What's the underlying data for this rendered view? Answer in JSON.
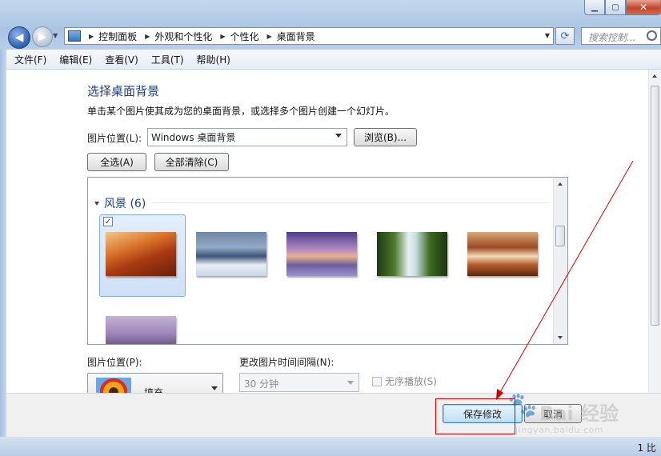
{
  "window": {
    "controls": {
      "minimize": "▁",
      "maximize": "▢",
      "close": "✕"
    }
  },
  "navigation": {
    "back_glyph": "◀",
    "forward_glyph": "▶",
    "history_glyph": "▼"
  },
  "address_bar": {
    "crumbs": [
      "控制面板",
      "外观和个性化",
      "个性化",
      "桌面背景"
    ],
    "separator": "▶",
    "dropdown_glyph": "▼",
    "refresh_glyph": "⟳"
  },
  "search": {
    "placeholder": "搜索控制..."
  },
  "menu": {
    "items": [
      "文件(F)",
      "编辑(E)",
      "查看(V)",
      "工具(T)",
      "帮助(H)"
    ]
  },
  "main": {
    "title": "选择桌面背景",
    "description": "单击某个图片使其成为您的桌面背景，或选择多个图片创建一个幻灯片。",
    "location_label": "图片位置(L):",
    "location_value": "Windows 桌面背景",
    "browse_button": "浏览(B)...",
    "select_all_button": "全选(A)",
    "clear_all_button": "全部清除(C)",
    "gallery": {
      "group_name": "风景 (6)",
      "checkmark": "✓"
    },
    "position_label": "图片位置(P):",
    "position_value": "填充",
    "interval_label": "更改图片时间间隔(N):",
    "interval_value": "30 分钟",
    "shuffle_label": "无序播放(S)"
  },
  "footer": {
    "save_button": "保存修改",
    "cancel_button": "取消"
  },
  "statusbar": {
    "text": "1 比"
  },
  "watermark": {
    "paw": "🐾",
    "text": "Bai 经验",
    "url": "jingyan.baidu.com"
  },
  "colors": {
    "accent_title": "#1e3f80",
    "annotation_red": "#d40000",
    "selected_tile": "#cfe0f7"
  }
}
